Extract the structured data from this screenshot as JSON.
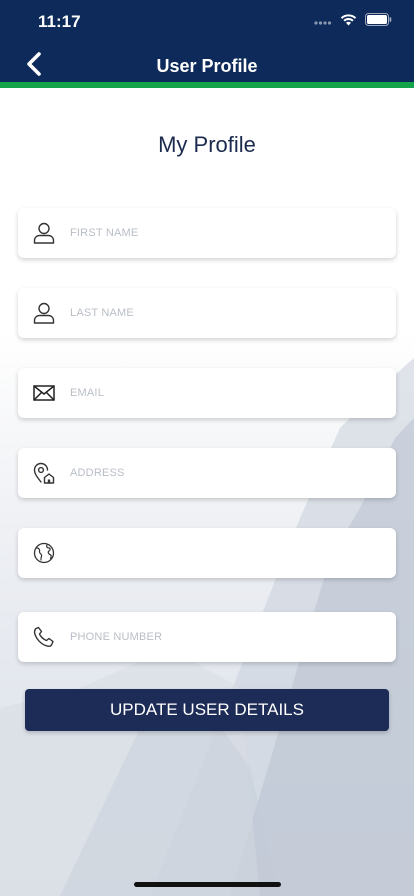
{
  "status_bar": {
    "time": "11:17"
  },
  "header": {
    "title": "User Profile",
    "back_icon": "chevron-left-icon",
    "background": "#0e2a5a",
    "accent": "#13a34a"
  },
  "page": {
    "title": "My Profile"
  },
  "form": {
    "fields": [
      {
        "name": "first-name-field",
        "icon": "person-icon",
        "placeholder": "FIRST NAME",
        "value": ""
      },
      {
        "name": "last-name-field",
        "icon": "person-icon",
        "placeholder": "LAST NAME",
        "value": ""
      },
      {
        "name": "email-field",
        "icon": "envelope-icon",
        "placeholder": "EMAIL",
        "value": ""
      },
      {
        "name": "address-field",
        "icon": "location-home-icon",
        "placeholder": "ADDRESS",
        "value": ""
      },
      {
        "name": "country-field",
        "icon": "globe-icon",
        "placeholder": "",
        "value": ""
      },
      {
        "name": "phone-number-field",
        "icon": "phone-icon",
        "placeholder": "PHONE NUMBER",
        "value": ""
      }
    ],
    "submit_label": "UPDATE USER DETAILS",
    "submit_color": "#1d2b57"
  }
}
